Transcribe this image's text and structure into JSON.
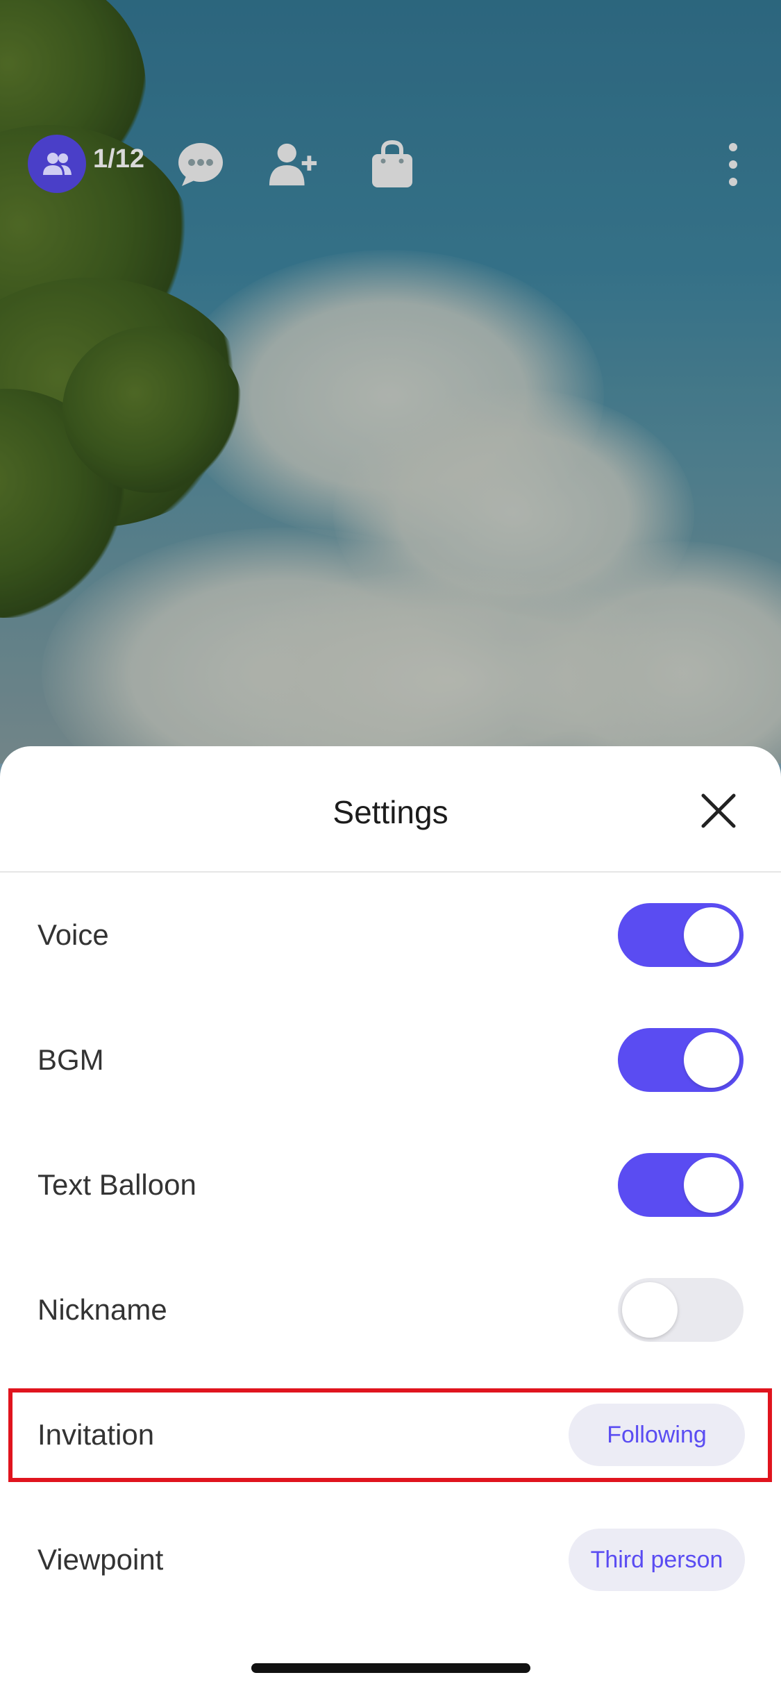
{
  "hud": {
    "player_count": "1/12",
    "icons": [
      "people-icon",
      "chat-icon",
      "add-friend-icon",
      "shop-bag-icon",
      "more-vertical-icon"
    ],
    "accent": "#4a3fc8"
  },
  "settings": {
    "title": "Settings",
    "close_icon": "close-icon",
    "rows": [
      {
        "label": "Voice",
        "type": "toggle",
        "on": true
      },
      {
        "label": "BGM",
        "type": "toggle",
        "on": true
      },
      {
        "label": "Text Balloon",
        "type": "toggle",
        "on": true
      },
      {
        "label": "Nickname",
        "type": "toggle",
        "on": false
      },
      {
        "label": "Invitation",
        "type": "option",
        "value": "Following"
      },
      {
        "label": "Viewpoint",
        "type": "option",
        "value": "Third person"
      }
    ],
    "toggle_on_color": "#5a4cf2",
    "toggle_off_color": "#e9e9ee",
    "highlight_color": "#e0141e"
  }
}
